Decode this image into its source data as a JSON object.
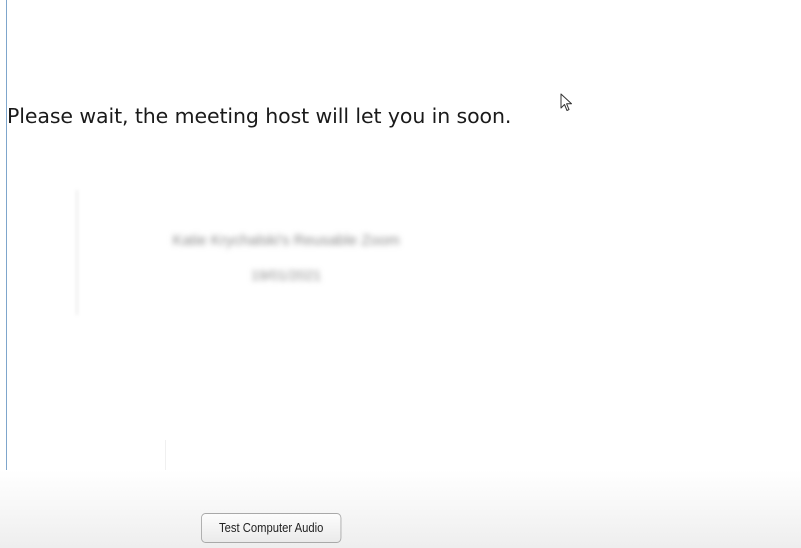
{
  "waiting_room": {
    "message": "Please wait, the meeting host will let you in soon.",
    "meeting_title": "Katie Krychalski's Reusable Zoom",
    "meeting_date": "19/01/2021"
  },
  "footer": {
    "test_audio_label": "Test Computer Audio"
  },
  "icons": {
    "cursor": "mouse-pointer-icon"
  },
  "colors": {
    "window_border": "#7fa6cc",
    "background": "#ffffff"
  }
}
